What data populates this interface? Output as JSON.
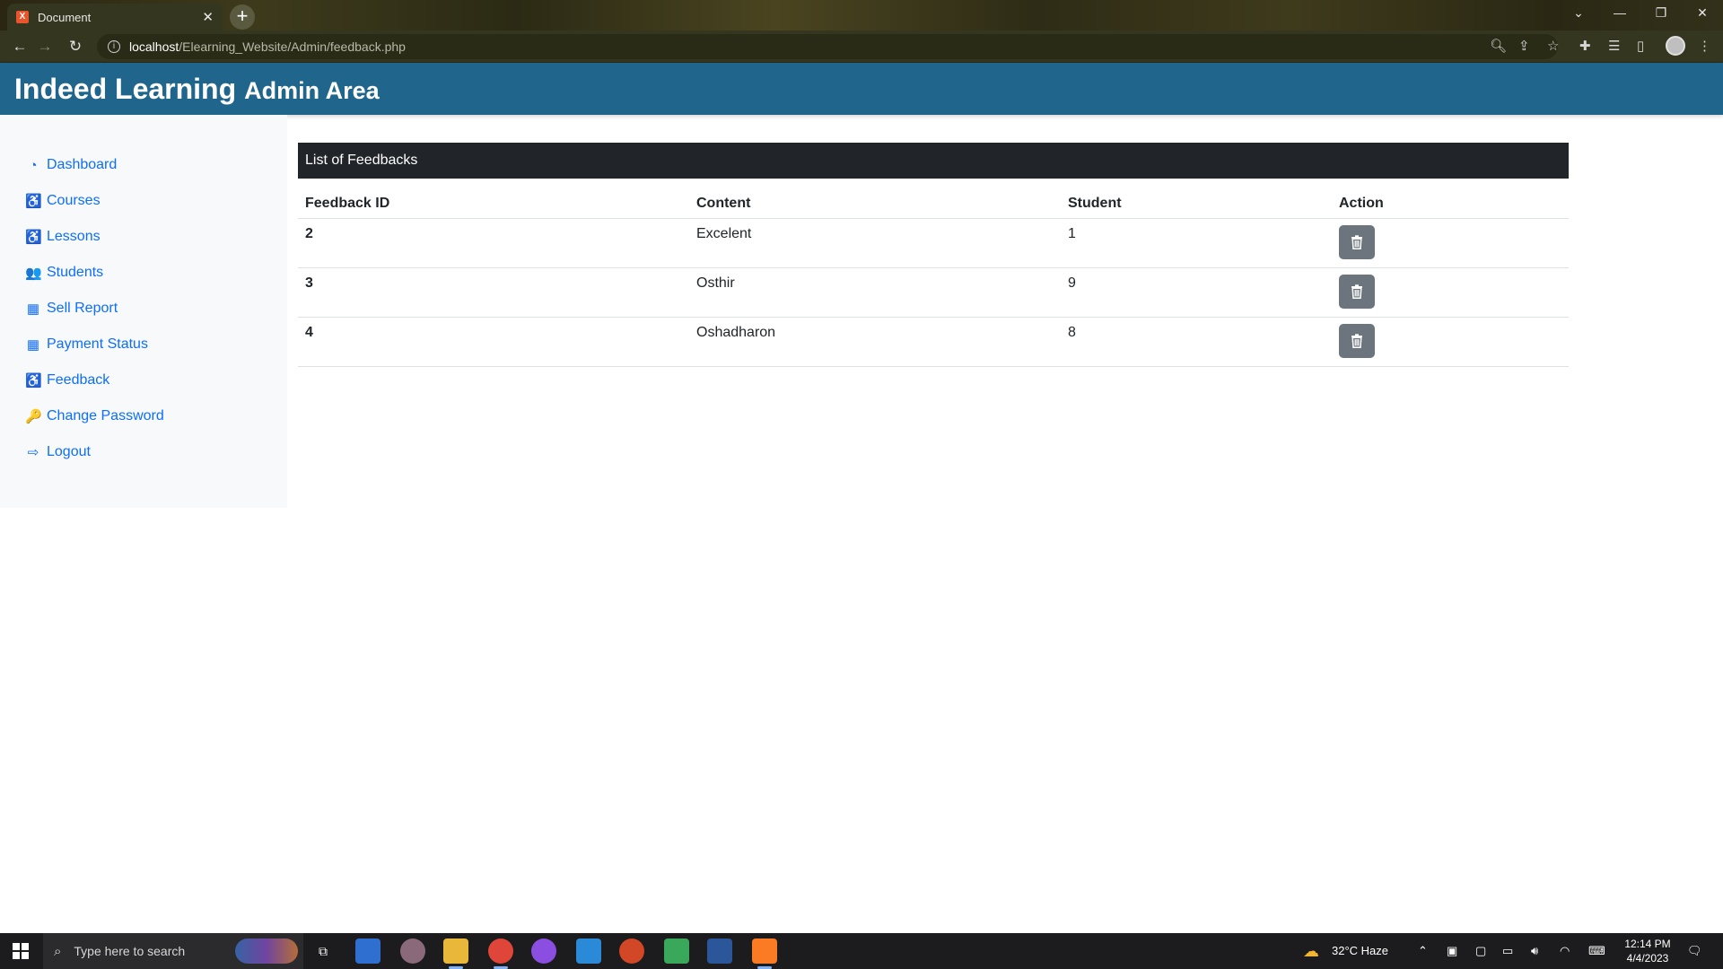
{
  "browser": {
    "tab_title": "Document",
    "tab_favicon": "X",
    "url_host": "localhost",
    "url_path": "/Elearning_Website/Admin/feedback.php"
  },
  "header": {
    "brand_main": "Indeed Learning",
    "brand_sub": "Admin Area",
    "bg_color": "#20668c"
  },
  "sidebar": {
    "items": [
      {
        "label": "Dashboard",
        "icon": "dashboard-icon",
        "glyph": "◔"
      },
      {
        "label": "Courses",
        "icon": "accessibility-icon",
        "glyph": "♿"
      },
      {
        "label": "Lessons",
        "icon": "accessibility-icon",
        "glyph": "♿"
      },
      {
        "label": "Students",
        "icon": "users-icon",
        "glyph": "👥"
      },
      {
        "label": "Sell Report",
        "icon": "table-icon",
        "glyph": "▦"
      },
      {
        "label": "Payment Status",
        "icon": "table-icon",
        "glyph": "▦"
      },
      {
        "label": "Feedback",
        "icon": "accessibility-icon",
        "glyph": "♿"
      },
      {
        "label": "Change Password",
        "icon": "key-icon",
        "glyph": "🔑"
      },
      {
        "label": "Logout",
        "icon": "sign-out-icon",
        "glyph": "⇨"
      }
    ]
  },
  "main": {
    "card_title": "List of Feedbacks",
    "columns": [
      "Feedback ID",
      "Content",
      "Student",
      "Action"
    ],
    "rows": [
      {
        "id": "2",
        "content": "Excelent",
        "student": "1"
      },
      {
        "id": "3",
        "content": "Osthir",
        "student": "9"
      },
      {
        "id": "4",
        "content": "Oshadharon",
        "student": "8"
      }
    ]
  },
  "taskbar": {
    "search_placeholder": "Type here to search",
    "weather": "32°C  Haze",
    "time": "12:14 PM",
    "date": "4/4/2023"
  }
}
